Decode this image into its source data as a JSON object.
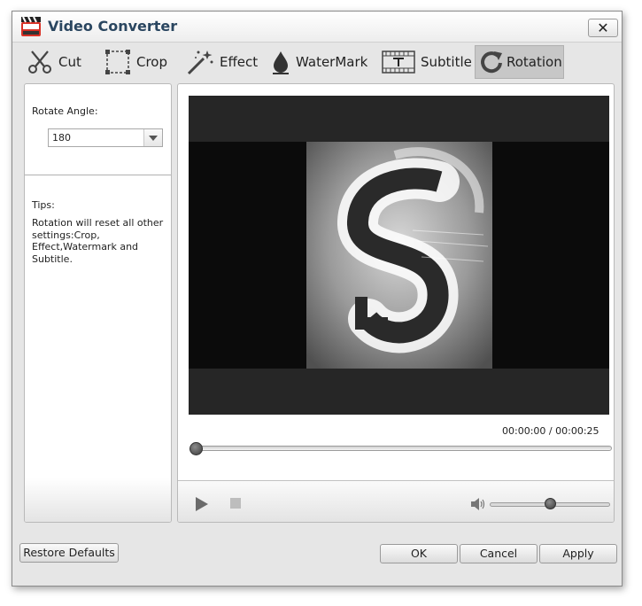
{
  "window": {
    "title": "Video Converter",
    "close_symbol": "✕"
  },
  "toolbar": {
    "items": [
      {
        "label": "Cut",
        "icon": "scissors-icon"
      },
      {
        "label": "Crop",
        "icon": "crop-icon"
      },
      {
        "label": "Effect",
        "icon": "magic-wand-icon"
      },
      {
        "label": "WaterMark",
        "icon": "droplet-icon"
      },
      {
        "label": "Subtitle",
        "icon": "subtitle-icon"
      },
      {
        "label": "Rotation",
        "icon": "rotate-icon",
        "active": true
      }
    ]
  },
  "left_panel": {
    "rotate_label": "Rotate Angle:",
    "rotate_value": "180",
    "tips_title": "Tips:",
    "tips_text": "Rotation will reset all other settings:Crop, Effect,Watermark and Subtitle."
  },
  "player": {
    "current_time": "00:00:00",
    "separator": "/",
    "total_time": "00:00:25",
    "progress": 0,
    "volume": 0.5
  },
  "footer": {
    "restore_label": "Restore Defaults",
    "ok_label": "OK",
    "cancel_label": "Cancel",
    "apply_label": "Apply"
  },
  "colors": {
    "title_text": "#2a4660",
    "active_tab_bg": "#c7c7c7",
    "video_bg": "#262626"
  }
}
